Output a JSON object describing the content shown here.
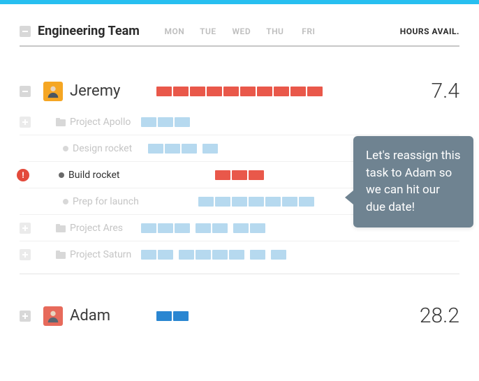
{
  "header": {
    "team_name": "Engineering Team",
    "days": [
      "MON",
      "TUE",
      "WED",
      "THU",
      "FRI"
    ],
    "hours_label": "HOURS AVAIL."
  },
  "people": [
    {
      "name": "Jeremy",
      "hours": "7.4",
      "bar_color": "red",
      "segments": 10,
      "rows": [
        {
          "type": "project",
          "label": "Project Apollo",
          "segments": [
            {
              "c": "lblue",
              "n": 3
            }
          ]
        },
        {
          "type": "task",
          "label": "Design rocket",
          "segments": [
            {
              "c": "lblue",
              "n": 3
            },
            {
              "c": "spacer",
              "n": 0.2
            },
            {
              "c": "lblue",
              "n": 1
            }
          ]
        },
        {
          "type": "task",
          "label": "Build rocket",
          "alert": true,
          "dark": true,
          "segments": [
            {
              "c": "spacer",
              "n": 4
            },
            {
              "c": "red",
              "n": 3
            }
          ]
        },
        {
          "type": "task",
          "label": "Prep for launch",
          "segments": [
            {
              "c": "spacer",
              "n": 3
            },
            {
              "c": "lblue",
              "n": 7
            }
          ]
        },
        {
          "type": "project",
          "label": "Project Ares",
          "segments": [
            {
              "c": "lblue",
              "n": 3
            },
            {
              "c": "spacer",
              "n": 0.2
            },
            {
              "c": "lblue",
              "n": 2
            },
            {
              "c": "spacer",
              "n": 0.2
            },
            {
              "c": "lblue",
              "n": 2
            }
          ]
        },
        {
          "type": "project",
          "label": "Project Saturn",
          "segments": [
            {
              "c": "lblue",
              "n": 2
            },
            {
              "c": "spacer",
              "n": 0.2
            },
            {
              "c": "lblue",
              "n": 4
            },
            {
              "c": "spacer",
              "n": 0.2
            },
            {
              "c": "lblue",
              "n": 1
            },
            {
              "c": "spacer",
              "n": 0.2
            },
            {
              "c": "lblue",
              "n": 1
            }
          ]
        }
      ]
    },
    {
      "name": "Adam",
      "hours": "28.2",
      "bar_color": "blue",
      "segments": 2
    }
  ],
  "tooltip": "Let's reassign this task to Adam so we can hit our due date!"
}
